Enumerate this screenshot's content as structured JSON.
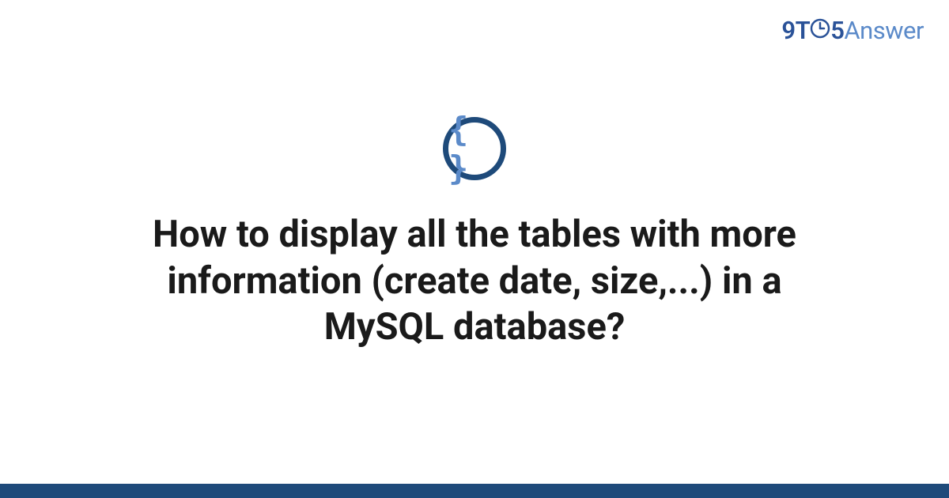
{
  "brand": {
    "prefix": "9T",
    "middle": "5",
    "suffix": "Answer"
  },
  "icon": {
    "glyph": "{ }",
    "name": "code-braces-icon"
  },
  "title": "How to display all the tables with more information (create date, size,...) in a MySQL database?",
  "colors": {
    "accent_dark": "#1e4a7a",
    "accent_light": "#5b8ac9"
  }
}
